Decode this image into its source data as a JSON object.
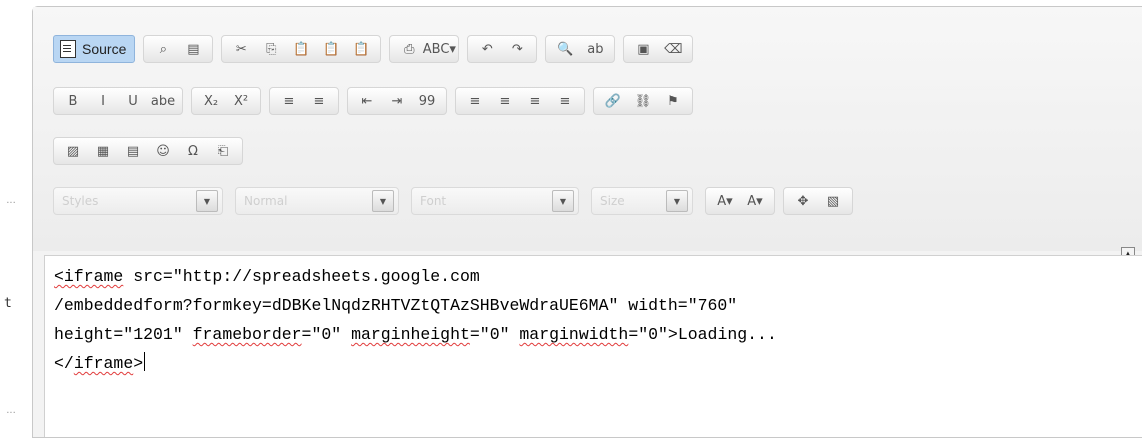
{
  "toolbar": {
    "source_label": "Source",
    "row1": [
      {
        "group": "document",
        "icons": [
          "preview-icon",
          "templates-icon"
        ],
        "glyphs": [
          "⌕",
          "▤"
        ]
      },
      {
        "group": "clipboard",
        "icons": [
          "cut-icon",
          "copy-icon",
          "paste-icon",
          "paste-text-icon",
          "paste-word-icon"
        ],
        "glyphs": [
          "✂",
          "⎘",
          "📋",
          "📋",
          "📋"
        ]
      },
      {
        "group": "editing",
        "icons": [
          "print-icon",
          "spellcheck-icon"
        ],
        "glyphs": [
          "⎙",
          "ABC▾"
        ]
      },
      {
        "group": "history",
        "icons": [
          "undo-icon",
          "redo-icon"
        ],
        "glyphs": [
          "↶",
          "↷"
        ]
      },
      {
        "group": "find",
        "icons": [
          "find-icon",
          "replace-icon"
        ],
        "glyphs": [
          "🔍",
          "ab"
        ]
      },
      {
        "group": "select",
        "icons": [
          "select-all-icon",
          "remove-format-icon"
        ],
        "glyphs": [
          "▣",
          "⌫"
        ]
      }
    ],
    "row2": [
      {
        "group": "basic-styles",
        "icons": [
          "bold-icon",
          "italic-icon",
          "underline-icon",
          "strike-icon"
        ],
        "glyphs": [
          "B",
          "I",
          "U",
          "abe"
        ]
      },
      {
        "group": "script",
        "icons": [
          "subscript-icon",
          "superscript-icon"
        ],
        "glyphs": [
          "X₂",
          "X²"
        ]
      },
      {
        "group": "list",
        "icons": [
          "numbered-list-icon",
          "bulleted-list-icon"
        ],
        "glyphs": [
          "≡",
          "≡"
        ]
      },
      {
        "group": "indent",
        "icons": [
          "outdent-icon",
          "indent-icon",
          "blockquote-icon"
        ],
        "glyphs": [
          "⇤",
          "⇥",
          "99"
        ]
      },
      {
        "group": "align",
        "icons": [
          "align-left-icon",
          "align-center-icon",
          "align-right-icon",
          "justify-icon"
        ],
        "glyphs": [
          "≡",
          "≡",
          "≡",
          "≡"
        ]
      },
      {
        "group": "links",
        "icons": [
          "link-icon",
          "unlink-icon",
          "anchor-icon"
        ],
        "glyphs": [
          "🔗",
          "⛓",
          "⚑"
        ]
      }
    ],
    "row3": [
      {
        "group": "insert",
        "icons": [
          "image-icon",
          "table-icon",
          "horizontal-rule-icon",
          "smiley-icon",
          "special-char-icon",
          "page-break-icon"
        ],
        "glyphs": [
          "▨",
          "▦",
          "▤",
          "☺",
          "Ω",
          "⎗"
        ]
      }
    ],
    "row4": {
      "combos": [
        {
          "name": "styles-combo",
          "label": "Styles"
        },
        {
          "name": "format-combo",
          "label": "Normal"
        },
        {
          "name": "font-combo",
          "label": "Font"
        },
        {
          "name": "size-combo",
          "label": "Size"
        }
      ],
      "color_groups": [
        {
          "icons": [
            "text-color-icon",
            "bg-color-icon"
          ],
          "glyphs": [
            "A▾",
            "A▾"
          ]
        },
        {
          "icons": [
            "maximize-icon",
            "show-blocks-icon"
          ],
          "glyphs": [
            "✥",
            "▧"
          ]
        }
      ]
    }
  },
  "gutter": {
    "letter": "t"
  },
  "content": {
    "line1_a": "<iframe",
    "line1_b": " src=\"http://spreadsheets.google.com",
    "line2": "/embeddedform?formkey=dDBKelNqdzRHTVZtQTAzSHBveWdraUE6MA\" width=\"760\"",
    "line3_a": "height=\"1201\" ",
    "line3_b": "frameborder",
    "line3_c": "=\"0\" ",
    "line3_d": "marginheight",
    "line3_e": "=\"0\" ",
    "line3_f": "marginwidth",
    "line3_g": "=\"0\">Loading...",
    "line4_a": "</",
    "line4_b": "iframe",
    "line4_c": ">"
  },
  "colors": {
    "source_active": "#b9d6f3",
    "spellcheck_underline": "#e13b3b"
  }
}
